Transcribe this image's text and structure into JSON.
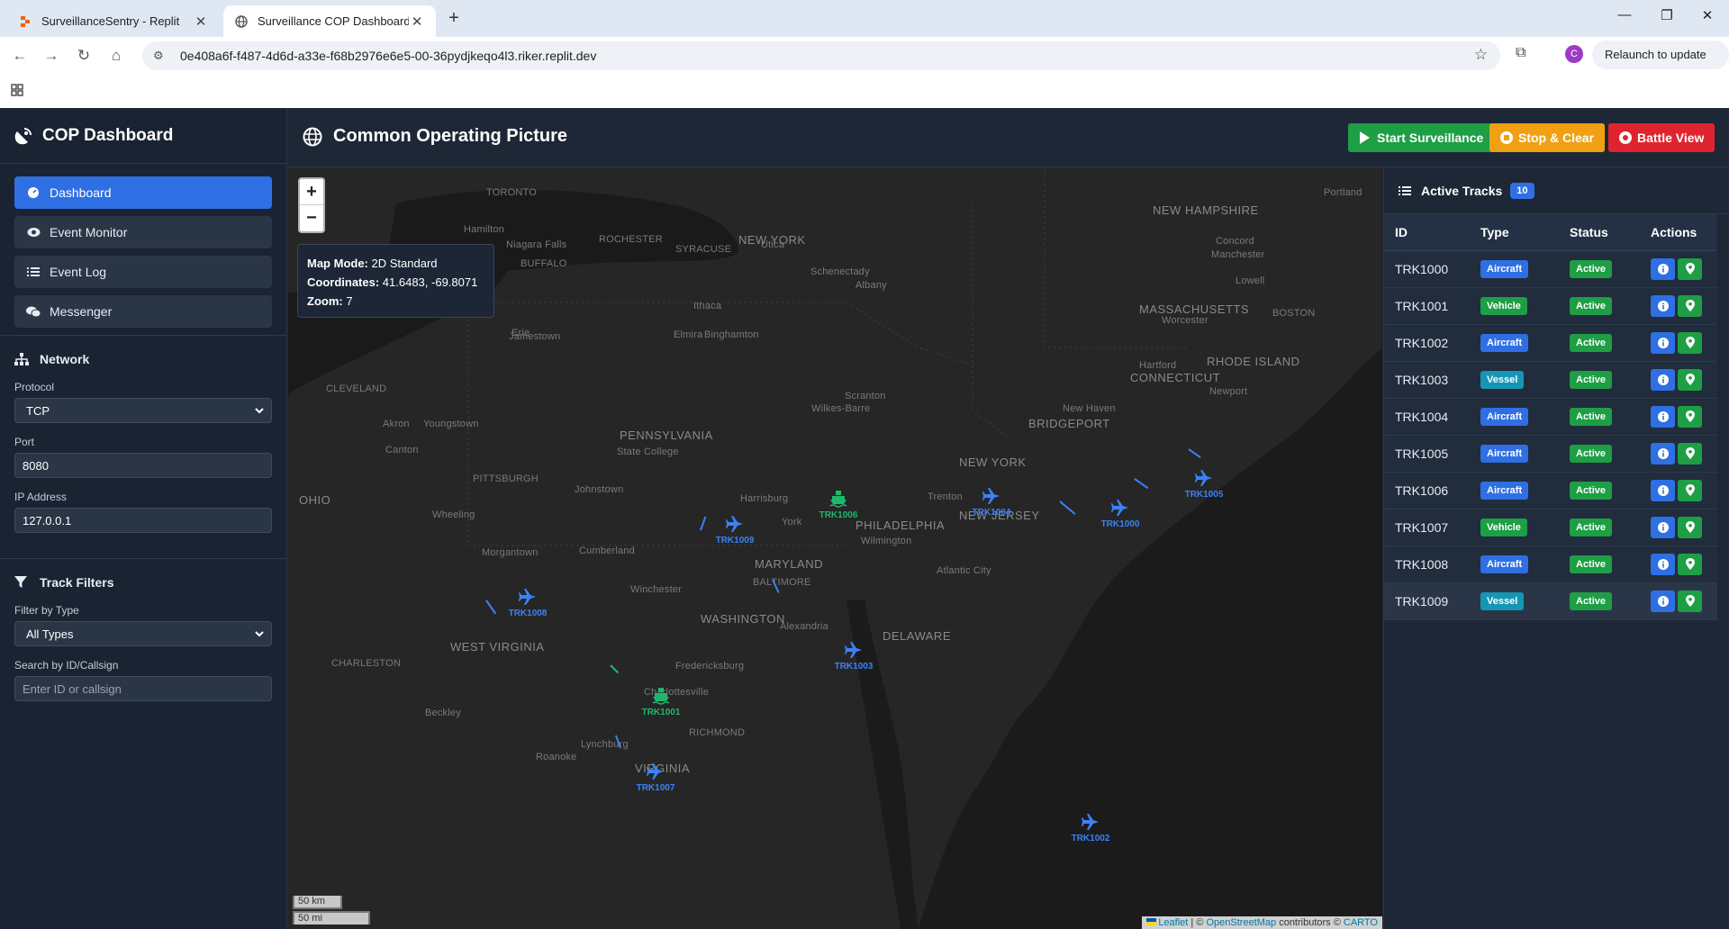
{
  "browser": {
    "tabs": [
      {
        "title": "SurveillanceSentry - Replit",
        "active": false
      },
      {
        "title": "Surveillance COP Dashboard",
        "active": true
      }
    ],
    "url": "0e408a6f-f487-4d6d-a33e-f68b2976e6e5-00-36pydjkeqo4l3.riker.replit.dev",
    "profile_initial": "C",
    "relaunch_label": "Relaunch to update"
  },
  "sidebar": {
    "brand": "COP Dashboard",
    "nav": [
      {
        "label": "Dashboard",
        "icon": "dashboard-icon",
        "active": true
      },
      {
        "label": "Event Monitor",
        "icon": "eye-icon",
        "active": false
      },
      {
        "label": "Event Log",
        "icon": "list-icon",
        "active": false
      },
      {
        "label": "Messenger",
        "icon": "chat-icon",
        "active": false
      }
    ],
    "network": {
      "title": "Network",
      "protocol_label": "Protocol",
      "protocol_value": "TCP",
      "port_label": "Port",
      "port_value": "8080",
      "ip_label": "IP Address",
      "ip_value": "127.0.0.1"
    },
    "filters": {
      "title": "Track Filters",
      "type_label": "Filter by Type",
      "type_value": "All Types",
      "search_label": "Search by ID/Callsign",
      "search_placeholder": "Enter ID or callsign"
    }
  },
  "header": {
    "title": "Common Operating Picture",
    "start_label": "Start Surveillance",
    "stop_label": "Stop & Clear",
    "battle_label": "Battle View"
  },
  "map": {
    "zoom_in": "+",
    "zoom_out": "−",
    "info": {
      "mode_label": "Map Mode:",
      "mode_value": "2D Standard",
      "coords_label": "Coordinates:",
      "coords_value": "41.6483, -69.8071",
      "zoom_label": "Zoom:",
      "zoom_value": "7"
    },
    "cities": [
      "TORONTO",
      "Hamilton",
      "Niagara Falls",
      "ROCHESTER",
      "SYRACUSE",
      "Utica",
      "BUFFALO",
      "NEW YORK",
      "Schenectady",
      "Albany",
      "Ithaca",
      "Elmira",
      "Binghamton",
      "Erie",
      "Jamestown",
      "CLEVELAND",
      "Akron",
      "Youngstown",
      "Canton",
      "PENNSYLVANIA",
      "State College",
      "Wilkes-Barre",
      "Scranton",
      "PITTSBURGH",
      "Johnstown",
      "Harrisburg",
      "OHIO",
      "Wheeling",
      "Morgantown",
      "Cumberland",
      "York",
      "PHILADELPHIA",
      "Wilmington",
      "Trenton",
      "NEW JERSEY",
      "MARYLAND",
      "BALTIMORE",
      "Atlantic City",
      "Winchester",
      "WASHINGTON",
      "Alexandria",
      "DELAWARE",
      "WEST VIRGINIA",
      "CHARLESTON",
      "Fredericksburg",
      "Charlottesville",
      "Beckley",
      "RICHMOND",
      "Lynchburg",
      "Roanoke",
      "VIRGINIA",
      "NEW HAMPSHIRE",
      "Portland",
      "Concord",
      "Manchester",
      "Lowell",
      "MASSACHUSETTS",
      "Worcester",
      "BOSTON",
      "Hartford",
      "CONNECTICUT",
      "RHODE ISLAND",
      "Newport",
      "New Haven",
      "BRIDGEPORT",
      "NEW YORK"
    ],
    "scale_km": "50 km",
    "scale_mi": "50 mi",
    "attribution": {
      "leaflet": "Leaflet",
      "sep": " | © ",
      "osm": "OpenStreetMap",
      "contrib": " contributors © ",
      "carto": "CARTO"
    },
    "tracks": [
      {
        "id": "TRK1000",
        "kind": "aircraft"
      },
      {
        "id": "TRK1001",
        "kind": "vessel"
      },
      {
        "id": "TRK1002",
        "kind": "aircraft"
      },
      {
        "id": "TRK1003",
        "kind": "aircraft"
      },
      {
        "id": "TRK1004",
        "kind": "aircraft"
      },
      {
        "id": "TRK1005",
        "kind": "aircraft"
      },
      {
        "id": "TRK1006",
        "kind": "vessel"
      },
      {
        "id": "TRK1007",
        "kind": "aircraft"
      },
      {
        "id": "TRK1008",
        "kind": "aircraft"
      },
      {
        "id": "TRK1009",
        "kind": "aircraft"
      }
    ]
  },
  "panel": {
    "title": "Active Tracks",
    "count": "10",
    "columns": [
      "ID",
      "Type",
      "Status",
      "Actions"
    ],
    "rows": [
      {
        "id": "TRK1000",
        "type": "Aircraft",
        "status": "Active"
      },
      {
        "id": "TRK1001",
        "type": "Vehicle",
        "status": "Active"
      },
      {
        "id": "TRK1002",
        "type": "Aircraft",
        "status": "Active"
      },
      {
        "id": "TRK1003",
        "type": "Vessel",
        "status": "Active"
      },
      {
        "id": "TRK1004",
        "type": "Aircraft",
        "status": "Active"
      },
      {
        "id": "TRK1005",
        "type": "Aircraft",
        "status": "Active"
      },
      {
        "id": "TRK1006",
        "type": "Aircraft",
        "status": "Active"
      },
      {
        "id": "TRK1007",
        "type": "Vehicle",
        "status": "Active"
      },
      {
        "id": "TRK1008",
        "type": "Aircraft",
        "status": "Active"
      },
      {
        "id": "TRK1009",
        "type": "Vessel",
        "status": "Active"
      }
    ]
  },
  "colors": {
    "primary": "#2f6fe4",
    "success": "#1e9e45",
    "warning": "#f0a012",
    "danger": "#e0242f",
    "info": "#1596b5",
    "track_blue": "#3b82f6",
    "track_green": "#1fb86b"
  }
}
